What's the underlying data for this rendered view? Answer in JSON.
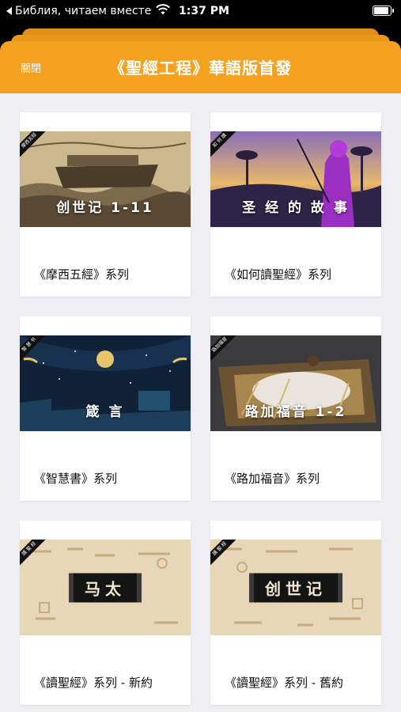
{
  "status_bar": {
    "back_label": "Библия, читаем вместе",
    "time": "1:37 PM"
  },
  "header": {
    "close_label": "關閉",
    "title": "《聖經工程》華語版首發"
  },
  "cards": [
    {
      "label": "《摩西五經》系列",
      "thumb_caption": "创世记 1-11",
      "badge": "摩西五經"
    },
    {
      "label": "《如何讀聖經》系列",
      "thumb_caption": "圣 经 的 故 事",
      "badge": "如 何 讀"
    },
    {
      "label": "《智慧書》系列",
      "thumb_caption": "箴 言",
      "badge": "智 慧 书"
    },
    {
      "label": "《路加福音》系列",
      "thumb_caption": "路加福音 1-2",
      "badge": "路加福音"
    },
    {
      "label": "《讀聖經》系列 - 新約",
      "thumb_caption": "马太",
      "badge": "讀 聖 經"
    },
    {
      "label": "《讀聖經》系列 - 舊約",
      "thumb_caption": "创世记",
      "badge": "讀 聖 經"
    }
  ],
  "colors": {
    "header": "#f4a11f",
    "background": "#efeff3"
  }
}
